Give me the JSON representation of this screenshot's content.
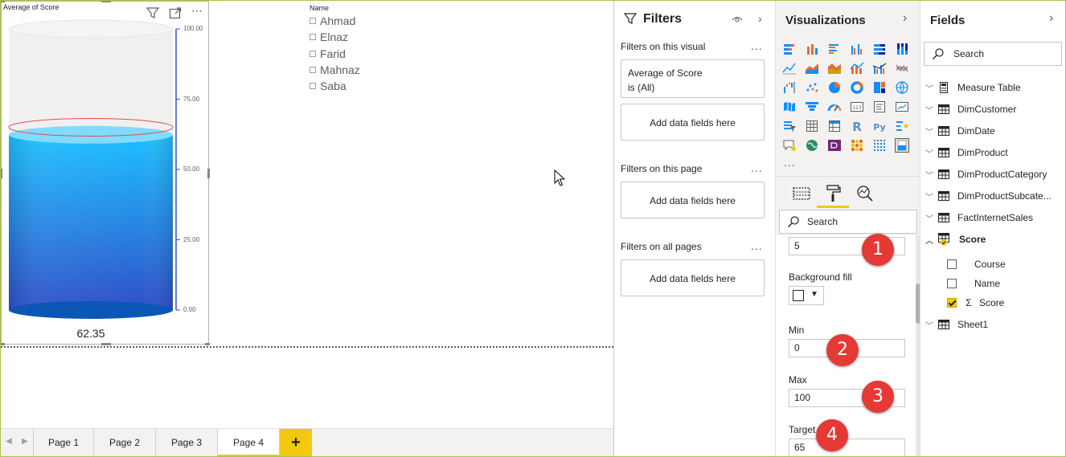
{
  "visual": {
    "title": "Average of Score",
    "value_label": "62.35",
    "axis_labels": [
      "100.00",
      "75.00",
      "50.00",
      "25.00",
      "0.00"
    ],
    "gauge": {
      "value": 62.35,
      "min": 0,
      "max": 100,
      "target": 65
    },
    "colors": {
      "liquid_top": "#1ec0ff",
      "liquid_bottom": "#2f4fc8",
      "target_line": "#e04c4c",
      "empty": "#f0f0f0"
    }
  },
  "slicer": {
    "header": "Name",
    "items": [
      "Ahmad",
      "Elnaz",
      "Farid",
      "Mahnaz",
      "Saba"
    ]
  },
  "page_tabs": {
    "tabs": [
      "Page 1",
      "Page 2",
      "Page 3",
      "Page 4"
    ],
    "active": "Page 4",
    "add_label": "+"
  },
  "filters": {
    "title": "Filters",
    "on_visual_label": "Filters on this visual",
    "visual_card": {
      "field": "Average of Score",
      "state": "is (All)"
    },
    "add_fields_label": "Add data fields here",
    "on_page_label": "Filters on this page",
    "on_all_label": "Filters on all pages",
    "ellipsis": "..."
  },
  "visualizations": {
    "title": "Visualizations",
    "more": "...",
    "search_placeholder": "Search",
    "format": {
      "top_value": "5",
      "background_fill_label": "Background fill",
      "min_label": "Min",
      "min_value": "0",
      "max_label": "Max",
      "max_value": "100",
      "target_label": "Target",
      "target_value": "65"
    },
    "badges": [
      "1",
      "2",
      "3",
      "4"
    ]
  },
  "fields": {
    "title": "Fields",
    "search_placeholder": "Search",
    "tables": [
      {
        "name": "Measure Table",
        "icon": "calculator-icon"
      },
      {
        "name": "DimCustomer",
        "icon": "table-icon"
      },
      {
        "name": "DimDate",
        "icon": "table-icon"
      },
      {
        "name": "DimProduct",
        "icon": "table-icon"
      },
      {
        "name": "DimProductCategory",
        "icon": "table-icon"
      },
      {
        "name": "DimProductSubcate...",
        "icon": "table-icon"
      },
      {
        "name": "FactInternetSales",
        "icon": "table-icon"
      },
      {
        "name": "Score",
        "icon": "table-icon",
        "expanded": true
      },
      {
        "name": "Sheet1",
        "icon": "table-icon"
      }
    ],
    "score_fields": [
      {
        "name": "Course",
        "checked": false
      },
      {
        "name": "Name",
        "checked": false
      },
      {
        "name": "Score",
        "checked": true,
        "sigma": "Σ"
      }
    ]
  }
}
